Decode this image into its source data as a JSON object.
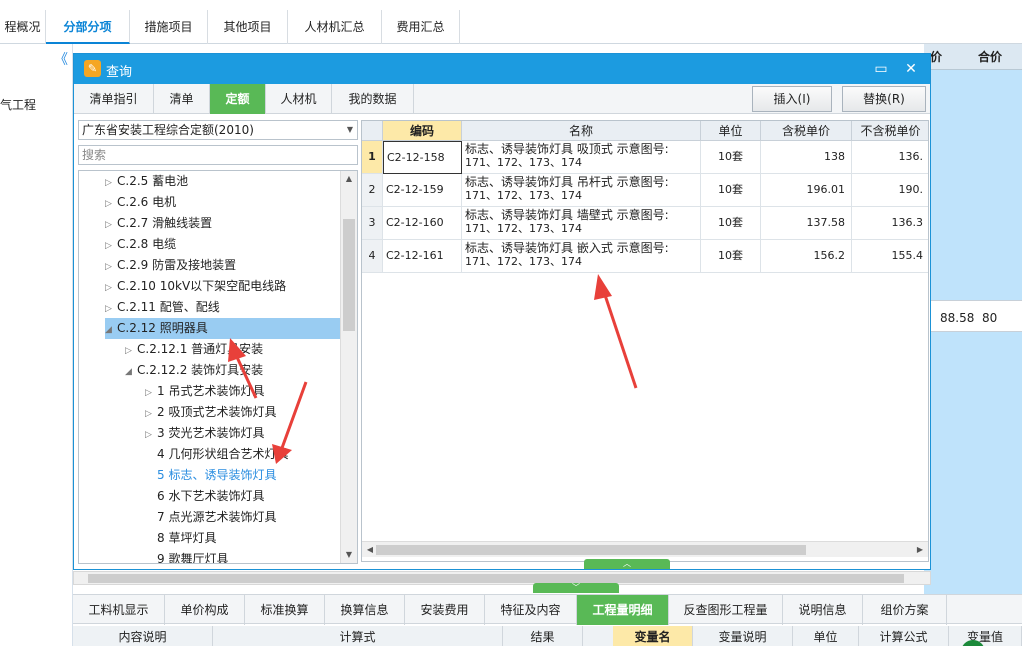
{
  "top_tabs": [
    "程概况",
    "分部分项",
    "措施项目",
    "其他项目",
    "人材机汇总",
    "费用汇总"
  ],
  "left_panel": {
    "item": "电气工程",
    "collapse": "《"
  },
  "bg": {
    "headers": [
      "价",
      "合价"
    ],
    "row_values": [
      "88.58",
      "80"
    ]
  },
  "dialog": {
    "title": "查询",
    "tabs": [
      "清单指引",
      "清单",
      "定额",
      "人材机",
      "我的数据"
    ],
    "insert_button": "插入(I)",
    "replace_button": "替换(R)",
    "library": "广东省安装工程综合定额(2010)",
    "search_placeholder": "搜索",
    "tree": [
      {
        "label": "C.2.5 蓄电池"
      },
      {
        "label": "C.2.6 电机"
      },
      {
        "label": "C.2.7 滑触线装置"
      },
      {
        "label": "C.2.8 电缆"
      },
      {
        "label": "C.2.9 防雷及接地装置"
      },
      {
        "label": "C.2.10 10kV以下架空配电线路"
      },
      {
        "label": "C.2.11 配管、配线"
      },
      {
        "label": "C.2.12 照明器具"
      },
      {
        "label": "C.2.12.1 普通灯具安装"
      },
      {
        "label": "C.2.12.2 装饰灯具安装"
      },
      {
        "label": "1 吊式艺术装饰灯具"
      },
      {
        "label": "2 吸顶式艺术装饰灯具"
      },
      {
        "label": "3 荧光艺术装饰灯具"
      },
      {
        "label": "4 几何形状组合艺术灯具"
      },
      {
        "label": "5 标志、诱导装饰灯具"
      },
      {
        "label": "6 水下艺术装饰灯具"
      },
      {
        "label": "7 点光源艺术装饰灯具"
      },
      {
        "label": "8 草坪灯具"
      },
      {
        "label": "9 歌舞厅灯具"
      }
    ],
    "grid": {
      "headers": [
        "",
        "编码",
        "名称",
        "单位",
        "含税单价",
        "不含税单价"
      ],
      "rows": [
        {
          "num": "1",
          "code": "C2-12-158",
          "name1": "标志、诱导装饰灯具 吸顶式 示意图号:",
          "name2": "171、172、173、174",
          "unit": "10套",
          "tax": "138",
          "notax": "136."
        },
        {
          "num": "2",
          "code": "C2-12-159",
          "name1": "标志、诱导装饰灯具 吊杆式 示意图号:",
          "name2": "171、172、173、174",
          "unit": "10套",
          "tax": "196.01",
          "notax": "190."
        },
        {
          "num": "3",
          "code": "C2-12-160",
          "name1": "标志、诱导装饰灯具 墙壁式 示意图号:",
          "name2": "171、172、173、174",
          "unit": "10套",
          "tax": "137.58",
          "notax": "136.3"
        },
        {
          "num": "4",
          "code": "C2-12-161",
          "name1": "标志、诱导装饰灯具 嵌入式 示意图号:",
          "name2": "171、172、173、174",
          "unit": "10套",
          "tax": "156.2",
          "notax": "155.4"
        }
      ]
    }
  },
  "bottom_tabs": [
    "工料机显示",
    "单价构成",
    "标准换算",
    "换算信息",
    "安装费用",
    "特征及内容",
    "工程量明细",
    "反查图形工程量",
    "说明信息",
    "组价方案"
  ],
  "bottom_headers": [
    "内容说明",
    "计算式",
    "结果",
    "变量名",
    "变量说明",
    "单位",
    "计算公式",
    "变量值"
  ],
  "colors": {
    "accent": "#1c9be0",
    "green": "#59b956",
    "selected": "#99ccf2",
    "arrow": "#e8403a"
  }
}
